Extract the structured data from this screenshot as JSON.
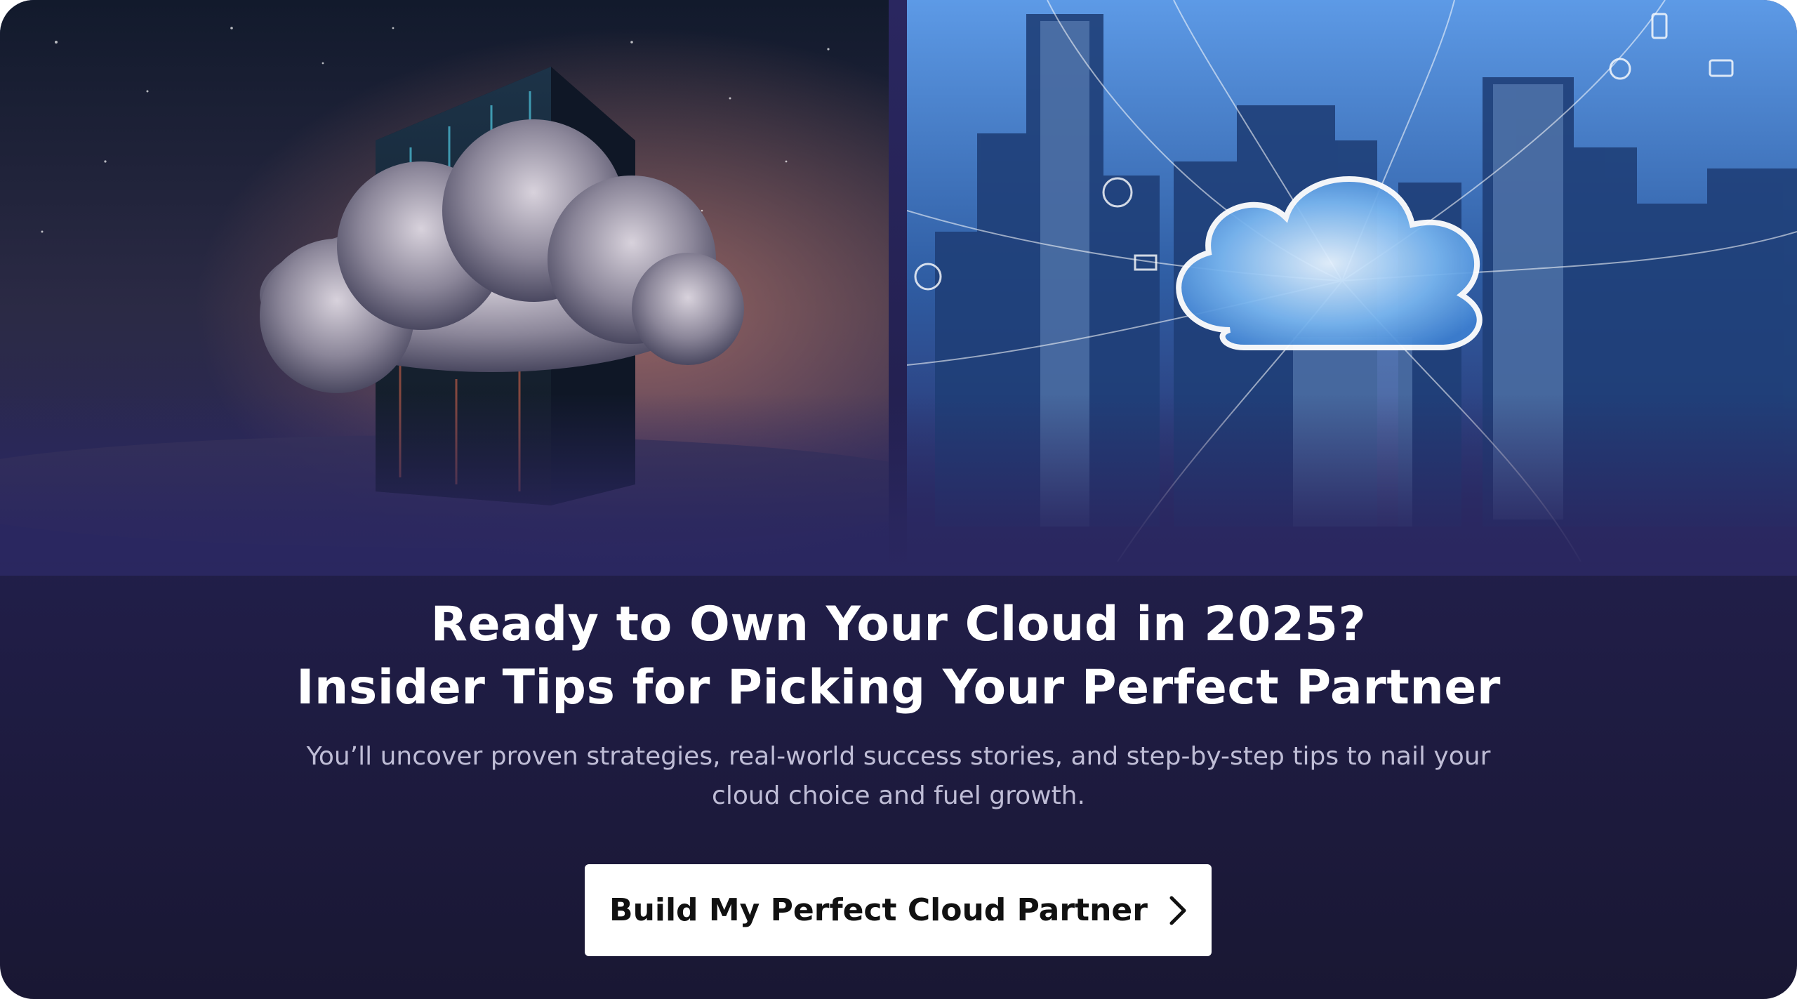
{
  "banner": {
    "headline_line1": "Ready to Own Your Cloud in 2025?",
    "headline_line2": "Insider Tips for Picking Your Perfect Partner",
    "subtext": "You’ll uncover proven strategies, real-world success stories, and step-by-step tips to nail your cloud choice and fuel growth.",
    "cta_label": "Build My Perfect Cloud Partner",
    "cta_icon": "chevron-right-icon"
  },
  "images": {
    "left": "server-cloud-illustration",
    "right": "city-cloud-network-illustration"
  },
  "colors": {
    "background_top": "#2a2760",
    "background_bottom": "#191733",
    "headline": "#ffffff",
    "subtext": "#bfbdd6",
    "button_bg": "#ffffff",
    "button_text": "#111111"
  }
}
